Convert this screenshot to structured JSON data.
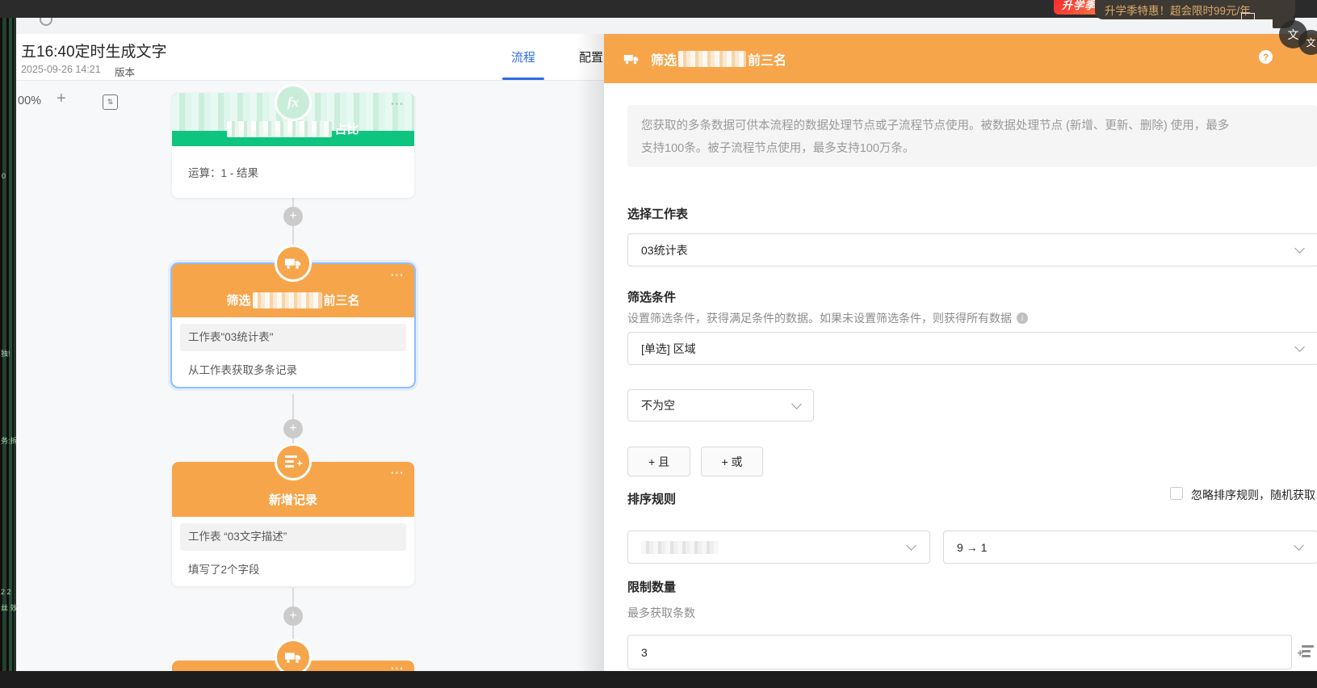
{
  "topbar": {
    "badge_text": "升学季",
    "promo_text": "升学季特惠！超会限时99元/年"
  },
  "header": {
    "title": "五16:40定时生成文字",
    "timestamp": "2025-09-26 14:21",
    "version_label": "版本",
    "tabs": {
      "flow": "流程",
      "config": "配置"
    }
  },
  "canvas": {
    "zoom_level": "00%",
    "zoom_in": "+",
    "fit_glyph": "⇅",
    "fragments": {
      "f1": "0",
      "f2": "独!",
      "f3": "务:拆",
      "f4": "2 2",
      "f5": "丝 效"
    }
  },
  "flow": {
    "nodes": [
      {
        "title_suffix": "占比",
        "body1": "运算：1 - 结果"
      },
      {
        "title_prefix": "筛选",
        "title_suffix": "前三名",
        "row1": "工作表\"03统计表\"",
        "row2": "从工作表获取多条记录"
      },
      {
        "title": "新增记录",
        "row1": "工作表 “03文字描述”",
        "row2": "填写了2个字段"
      },
      {}
    ]
  },
  "panel": {
    "title_prefix": "筛选",
    "title_suffix": "前三名",
    "description_line1": "您获取的多条数据可供本流程的数据处理节点或子流程节点使用。被数据处理节点 (新增、更新、删除) 使用，最多",
    "description_line2": "支持100条。被子流程节点使用，最多支持100万条。",
    "worksheet_label": "选择工作表",
    "worksheet_value": "03统计表",
    "filter_label": "筛选条件",
    "filter_help": "设置筛选条件，获得满足条件的数据。如果未设置筛选条件，则获得所有数据",
    "field_value": "[单选] 区域",
    "operator_value": "不为空",
    "and_button": "+ 且",
    "or_button": "+ 或",
    "sort_label": "排序规则",
    "ignore_sort_label": "忽略排序规则，随机获取",
    "sort_order_value": "9 → 1",
    "limit_label": "限制数量",
    "limit_help": "最多获取条数",
    "limit_value": "3"
  },
  "icons": {
    "more": "⋯",
    "plus": "+",
    "fx": "fx",
    "question": "?",
    "translate": "文",
    "info": "i",
    "list_plus": "+"
  },
  "colors": {
    "accent_orange": "#F6A54B",
    "accent_green": "#0EC57F",
    "accent_blue": "#2E6BE6",
    "selection_blue": "#8FBEFF"
  }
}
